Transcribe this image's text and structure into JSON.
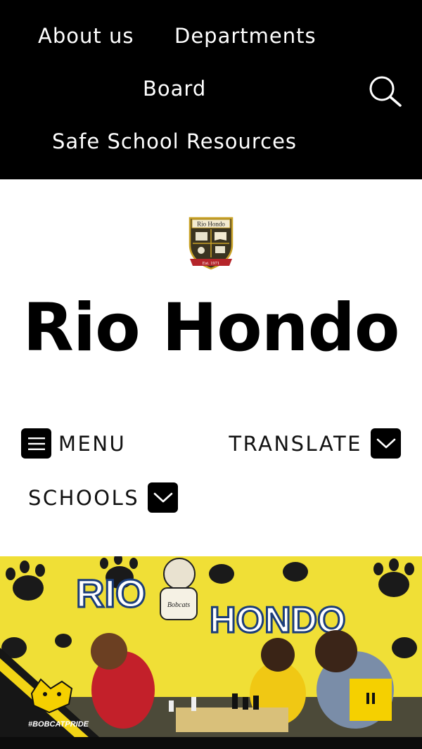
{
  "topnav": {
    "items": [
      {
        "label": "About us"
      },
      {
        "label": "Departments"
      },
      {
        "label": "Board"
      },
      {
        "label": "Safe School Resources"
      }
    ],
    "search_icon": "search-icon"
  },
  "header": {
    "title": "Rio Hondo",
    "crest": {
      "banner_text": "Rio Hondo",
      "ribbon_text": "Est. 1971"
    }
  },
  "toolbar": {
    "menu_label": "MENU",
    "translate_label": "TRANSLATE",
    "schools_label": "SCHOOLS"
  },
  "hero": {
    "headline_line1": "RIO",
    "headline_line2": "HONDO",
    "mascot_tag": "Bobcats",
    "hashtag": "#BOBCATPRIDE",
    "pause_icon": "pause-icon"
  },
  "colors": {
    "nav_bg": "#000000",
    "hero_yellow": "#f2e23a",
    "pause_yellow": "#f5d000",
    "title": "#000000"
  }
}
